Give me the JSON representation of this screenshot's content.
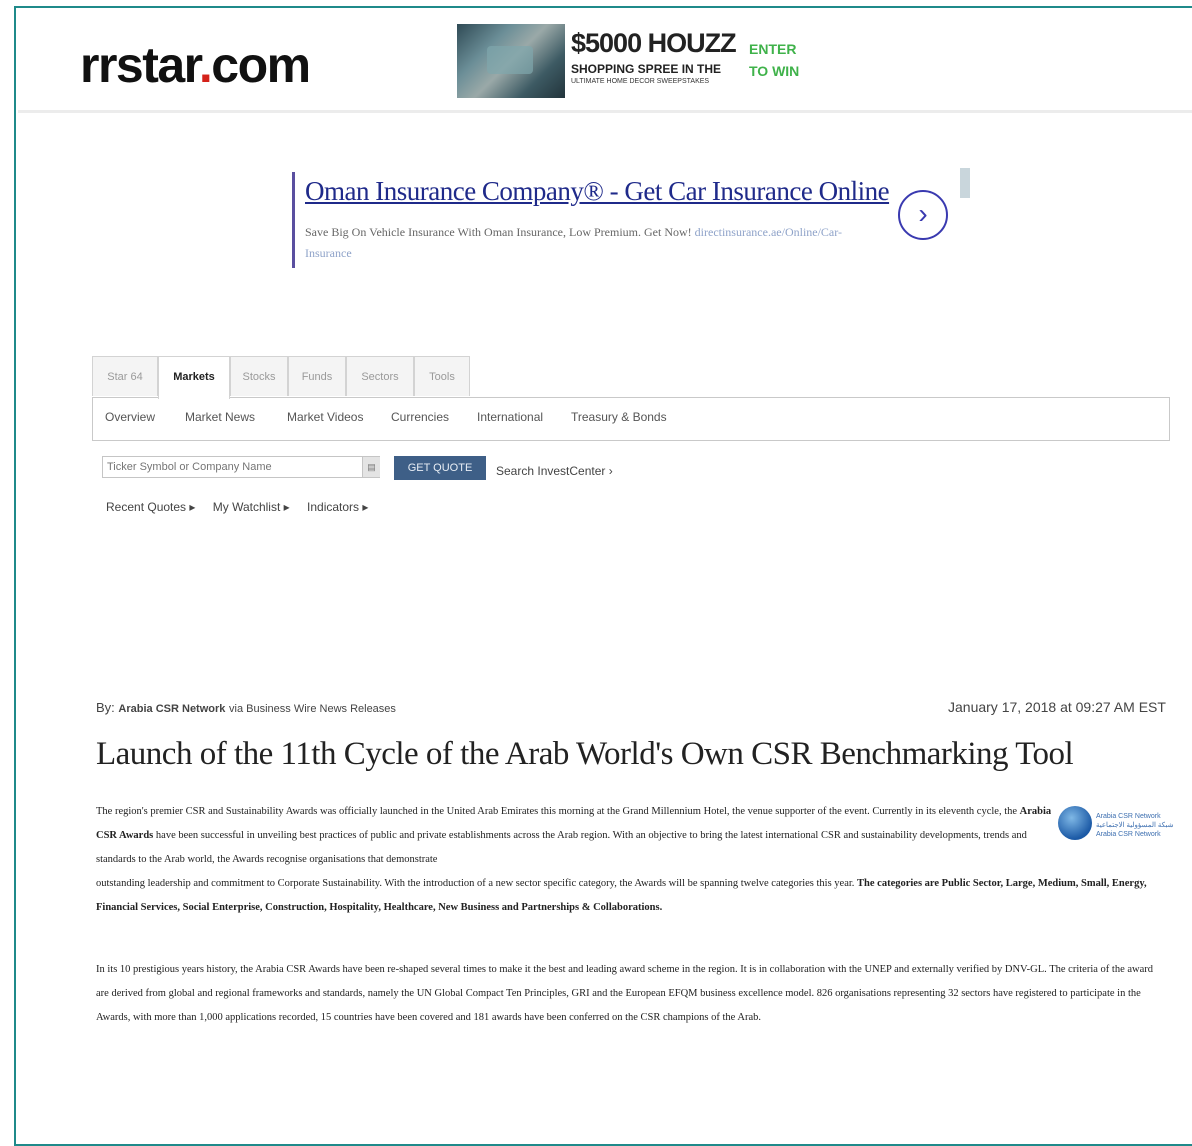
{
  "site": {
    "logo_text": "rrstar",
    "logo_dot": ".",
    "logo_tld": "com"
  },
  "banner_ad": {
    "title": "$5000 HOUZZ",
    "subtitle": "SHOPPING SPREE IN THE",
    "subtitle2": "ULTIMATE HOME DECOR SWEEPSTAKES",
    "cta_line1": "ENTER",
    "cta_line2": "TO WIN"
  },
  "text_ad": {
    "title": "Oman Insurance Company® - Get Car Insurance Online",
    "description": "Save Big On Vehicle Insurance With Oman Insurance, Low Premium. Get Now!",
    "url_text": "directinsurance.ae/Online/Car-Insurance",
    "next_icon": "chevron-right-icon"
  },
  "market_tabs": [
    "Star 64",
    "Markets",
    "Stocks",
    "Funds",
    "Sectors",
    "Tools"
  ],
  "active_tab": "Markets",
  "subnav": [
    "Overview",
    "Market News",
    "Market Videos",
    "Currencies",
    "International",
    "Treasury & Bonds"
  ],
  "quote_search": {
    "placeholder": "Ticker Symbol or Company Name",
    "button": "GET QUOTE",
    "search_link": "Search InvestCenter ›"
  },
  "quick_links": [
    "Recent Quotes ▸",
    "My Watchlist ▸",
    "Indicators ▸"
  ],
  "article": {
    "by_prefix": "By:",
    "author": "Arabia CSR Network",
    "source": "via Business Wire News Releases",
    "date": "January 17, 2018 at 09:27 AM EST",
    "headline": "Launch of the 11th Cycle of the Arab World's Own CSR Benchmarking Tool",
    "p1_lead": "The region's premier CSR and Sustainability Awards was officially launched in the United Arab Emirates this morning at the Grand Millennium Hotel, the venue supporter of the event. Currently in its eleventh cycle, the ",
    "p1_bold": "Arabia CSR Awards",
    "p1_rest": " have been successful in unveiling best practices of public and private establishments across the Arab region. With an objective to bring the latest international CSR and sustainability developments, trends and standards to the Arab world, the Awards recognise organisations that demonstrate",
    "p1b_lead": "outstanding leadership and commitment to Corporate Sustainability. With the introduction of a new sector specific category, the Awards will be spanning twelve categories this year. ",
    "p1b_bold": "The categories are Public Sector, Large, Medium, Small, Energy, Financial Services, Social Enterprise, Construction, Hospitality, Healthcare, New Business and Partnerships & Collaborations.",
    "p2": "In its 10 prestigious years history, the Arabia CSR Awards have been re-shaped several times to make it the best and leading award scheme in the region. It is in collaboration with the UNEP and externally verified by DNV-GL. The criteria of the award are derived from global and regional frameworks and standards, namely the UN Global Compact Ten Principles, GRI and the European EFQM business excellence model. 826 organisations representing 32 sectors have registered to participate in the Awards, with more than 1,000 applications recorded, 15 countries have been covered and 181 awards have been conferred on the CSR champions of the Arab.",
    "logo_text_1": "Arabia CSR Network",
    "logo_text_2": "شبكة المسؤولية الاجتماعية",
    "logo_text_3": "Arabia CSR Network"
  }
}
